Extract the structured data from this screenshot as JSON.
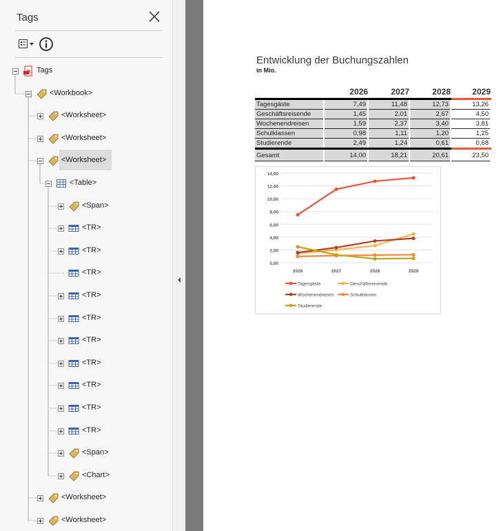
{
  "panel": {
    "title": "Tags",
    "close_icon": "close-icon",
    "options_icon": "tag-options-icon",
    "info_icon": "info-icon"
  },
  "tree": [
    {
      "label": "Tags",
      "level": 0,
      "icon": "pdf",
      "box": "expanded"
    },
    {
      "label": "<Workbook>",
      "level": 1,
      "icon": "tag",
      "box": "expanded"
    },
    {
      "label": "<Worksheet>",
      "level": 2,
      "icon": "tag",
      "box": "collapsed"
    },
    {
      "label": "<Worksheet>",
      "level": 2,
      "icon": "tag",
      "box": "collapsed"
    },
    {
      "label": "<Worksheet>",
      "level": 2,
      "icon": "tag",
      "box": "expanded",
      "selected": true
    },
    {
      "label": "<Table>",
      "level": 3,
      "icon": "table",
      "box": "expanded"
    },
    {
      "label": "<Span>",
      "level": 4,
      "icon": "tag",
      "box": "collapsed"
    },
    {
      "label": "<TR>",
      "level": 4,
      "icon": "row",
      "box": "collapsed"
    },
    {
      "label": "<TR>",
      "level": 4,
      "icon": "row",
      "box": "collapsed"
    },
    {
      "label": "<TR>",
      "level": 4,
      "icon": "row",
      "box": "none"
    },
    {
      "label": "<TR>",
      "level": 4,
      "icon": "row",
      "box": "collapsed"
    },
    {
      "label": "<TR>",
      "level": 4,
      "icon": "row",
      "box": "collapsed"
    },
    {
      "label": "<TR>",
      "level": 4,
      "icon": "row",
      "box": "collapsed"
    },
    {
      "label": "<TR>",
      "level": 4,
      "icon": "row",
      "box": "collapsed"
    },
    {
      "label": "<TR>",
      "level": 4,
      "icon": "row",
      "box": "collapsed"
    },
    {
      "label": "<TR>",
      "level": 4,
      "icon": "row",
      "box": "collapsed"
    },
    {
      "label": "<TR>",
      "level": 4,
      "icon": "row",
      "box": "collapsed"
    },
    {
      "label": "<Span>",
      "level": 4,
      "icon": "tag",
      "box": "collapsed"
    },
    {
      "label": "<Chart>",
      "level": 4,
      "icon": "tag",
      "box": "collapsed"
    },
    {
      "label": "<Worksheet>",
      "level": 2,
      "icon": "tag",
      "box": "collapsed"
    },
    {
      "label": "<Worksheet>",
      "level": 2,
      "icon": "tag",
      "box": "collapsed"
    }
  ],
  "document": {
    "title": "Entwicklung der Buchungszahlen",
    "subtitle": "in Mio.",
    "table": {
      "headers": [
        "",
        "2026",
        "2027",
        "2028",
        "2029"
      ],
      "rows": [
        [
          "Tagesgäste",
          "7,49",
          "11,48",
          "12,73",
          "13,26"
        ],
        [
          "Geschäftsreisende",
          "1,45",
          "2,01",
          "2,67",
          "4,50"
        ],
        [
          "Wochenendreisen",
          "1,59",
          "2,37",
          "3,40",
          "3,81"
        ],
        [
          "Schulklassen",
          "0,98",
          "1,11",
          "1,20",
          "1,25"
        ],
        [
          "Studierende",
          "2,49",
          "1,24",
          "0,61",
          "0,68"
        ]
      ],
      "total": [
        "Gesamt",
        "14,00",
        "18,21",
        "20,61",
        "23,50"
      ]
    }
  },
  "chart_data": {
    "type": "line",
    "categories": [
      "2026",
      "2027",
      "2028",
      "2029"
    ],
    "ylim": [
      0,
      14
    ],
    "yticks": [
      "14,00",
      "12,00",
      "10,00",
      "8,00",
      "6,00",
      "4,00",
      "2,00",
      "0,00"
    ],
    "grid": true,
    "legend_position": "bottom",
    "series": [
      {
        "name": "Tagesgäste",
        "values": [
          7.49,
          11.48,
          12.73,
          13.26
        ],
        "color": "#e8553a"
      },
      {
        "name": "Geschäftsreisende",
        "values": [
          1.45,
          2.01,
          2.67,
          4.5
        ],
        "color": "#f7b44a"
      },
      {
        "name": "Wochenendreisen",
        "values": [
          1.59,
          2.37,
          3.4,
          3.81
        ],
        "color": "#b0432a"
      },
      {
        "name": "Schulklassen",
        "values": [
          0.98,
          1.11,
          1.2,
          1.25
        ],
        "color": "#f08a3c"
      },
      {
        "name": "Studierende",
        "values": [
          2.49,
          1.24,
          0.61,
          0.68
        ],
        "color": "#c9a00e"
      }
    ]
  }
}
